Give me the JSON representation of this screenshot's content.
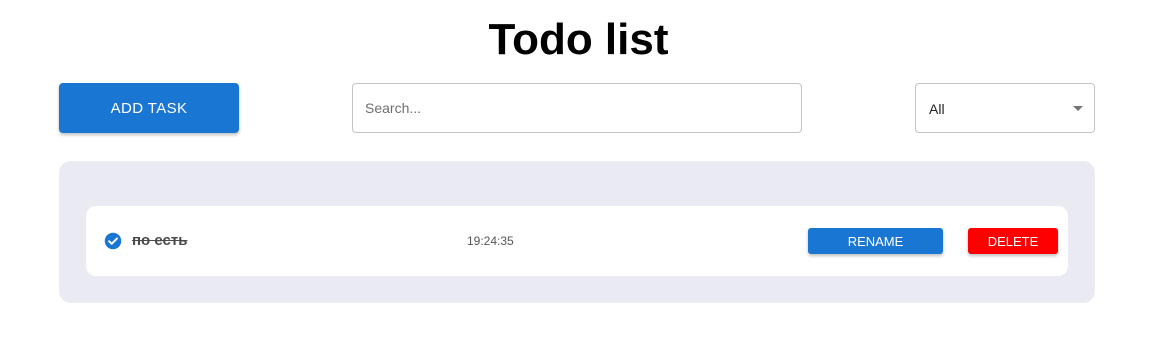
{
  "header": {
    "title": "Todo list"
  },
  "toolbar": {
    "add_task_label": "ADD TASK",
    "search": {
      "value": "",
      "placeholder": "Search..."
    },
    "filter": {
      "selected": "All"
    }
  },
  "tasks": [
    {
      "name": "по есть",
      "completed": true,
      "time": "19:24:35",
      "rename_label": "RENAME",
      "delete_label": "DELETE"
    }
  ],
  "colors": {
    "primary": "#1976d2",
    "danger": "#ff0000",
    "panel_background": "#eaebf2"
  },
  "icons": {
    "task_status": "check-circle-icon",
    "filter_dropdown": "caret-down-icon"
  }
}
